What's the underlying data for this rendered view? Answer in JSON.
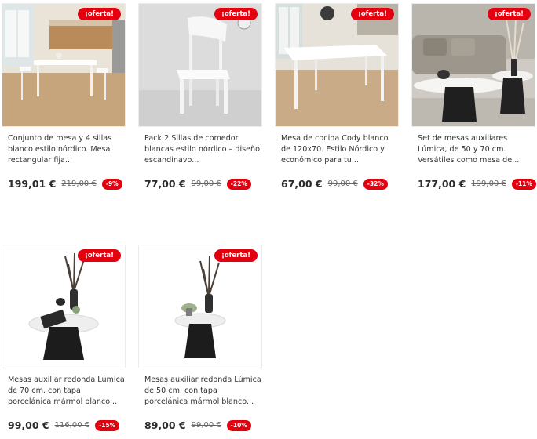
{
  "products": [
    {
      "title": "Conjunto de mesa y 4 sillas blanco estilo nórdico. Mesa rectangular fija...",
      "price": "199,01 €",
      "old_price": "219,00 €",
      "discount": "-9%",
      "badge": "¡oferta!",
      "image": "dining-set-kitchen-photo"
    },
    {
      "title": "Pack 2 Sillas de comedor blancas estilo nórdico – diseño escandinavo...",
      "price": "77,00 €",
      "old_price": "99,00 €",
      "discount": "-22%",
      "badge": "¡oferta!",
      "image": "white-chair-photo"
    },
    {
      "title": "Mesa de cocina Cody blanco de 120x70. Estilo Nórdico y económico para tu...",
      "price": "67,00 €",
      "old_price": "99,00 €",
      "discount": "-32%",
      "badge": "¡oferta!",
      "image": "white-table-photo"
    },
    {
      "title": "Set de mesas auxiliares Lúmica, de 50 y 70 cm. Versátiles como mesa de...",
      "price": "177,00 €",
      "old_price": "199,00 €",
      "discount": "-11%",
      "badge": "¡oferta!",
      "image": "side-tables-living-room-photo"
    },
    {
      "title": "Mesas auxiliar redonda Lúmica de 70 cm. con tapa porcelánica mármol blanco...",
      "price": "99,00 €",
      "old_price": "116,00 €",
      "discount": "-15%",
      "badge": "¡oferta!",
      "image": "round-side-table-70-photo"
    },
    {
      "title": "Mesas auxiliar redonda Lúmica de 50 cm. con tapa porcelánica mármol blanco...",
      "price": "89,00 €",
      "old_price": "99,00 €",
      "discount": "-10%",
      "badge": "¡oferta!",
      "image": "round-side-table-50-photo"
    }
  ],
  "colors": {
    "badge": "#e3000f",
    "text": "#333333",
    "price": "#2b2b2b"
  }
}
